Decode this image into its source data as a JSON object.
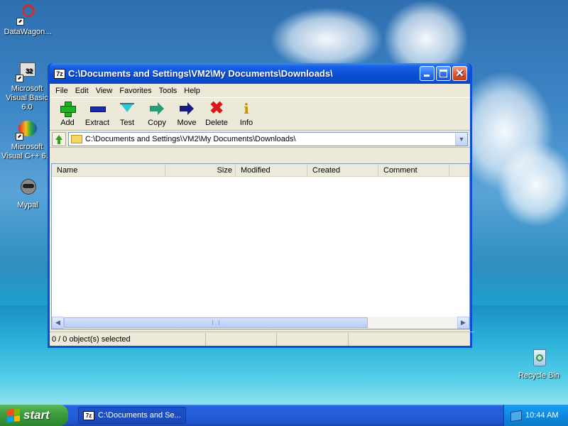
{
  "desktop": {
    "icons": [
      {
        "label": "DataWagon..."
      },
      {
        "label": "Microsoft Visual Basic 6.0"
      },
      {
        "label": "Microsoft Visual C++ 6.0"
      },
      {
        "label": "Mypal"
      },
      {
        "label": "Recycle Bin"
      }
    ]
  },
  "window": {
    "title": "C:\\Documents and Settings\\VM2\\My Documents\\Downloads\\",
    "app_badge": "7z",
    "menu": [
      "File",
      "Edit",
      "View",
      "Favorites",
      "Tools",
      "Help"
    ],
    "toolbar": [
      {
        "label": "Add",
        "icon": "add-icon"
      },
      {
        "label": "Extract",
        "icon": "extract-icon"
      },
      {
        "label": "Test",
        "icon": "test-icon"
      },
      {
        "label": "Copy",
        "icon": "copy-icon"
      },
      {
        "label": "Move",
        "icon": "move-icon"
      },
      {
        "label": "Delete",
        "icon": "delete-icon"
      },
      {
        "label": "Info",
        "icon": "info-icon"
      }
    ],
    "address": "C:\\Documents and Settings\\VM2\\My Documents\\Downloads\\",
    "columns": [
      "Name",
      "Size",
      "Modified",
      "Created",
      "Comment"
    ],
    "status": "0 / 0 object(s) selected"
  },
  "taskbar": {
    "start_label": "start",
    "task_label": "C:\\Documents and Se...",
    "task_badge": "7z",
    "clock": "10:44 AM"
  }
}
